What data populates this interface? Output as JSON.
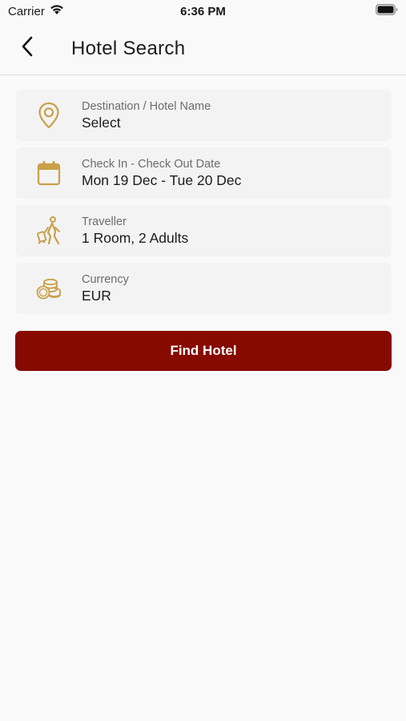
{
  "status_bar": {
    "carrier": "Carrier",
    "time": "6:36 PM"
  },
  "header": {
    "title": "Hotel Search",
    "back_icon": "chevron-left-icon"
  },
  "form": {
    "destination": {
      "label": "Destination / Hotel Name",
      "value": "Select",
      "icon": "location-pin-icon"
    },
    "dates": {
      "label": "Check In - Check Out Date",
      "value": "Mon 19 Dec - Tue 20 Dec",
      "icon": "calendar-icon"
    },
    "traveller": {
      "label": "Traveller",
      "value": "1 Room, 2 Adults",
      "icon": "traveller-icon"
    },
    "currency": {
      "label": "Currency",
      "value": "EUR",
      "icon": "coins-icon"
    }
  },
  "actions": {
    "find_label": "Find Hotel"
  },
  "colors": {
    "accent_gold": "#c9a04a",
    "button_red": "#870a00"
  }
}
